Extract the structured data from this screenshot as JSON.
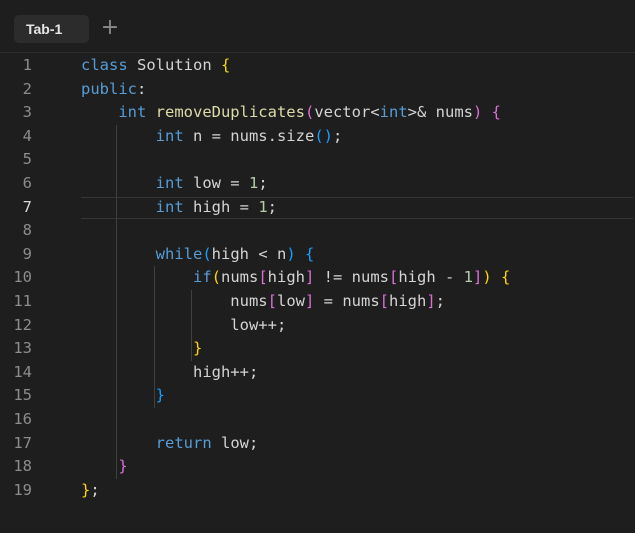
{
  "tabs": [
    {
      "label": "Tab-1"
    }
  ],
  "add_tab_symbol": "+",
  "editor": {
    "line_numbers": [
      "1",
      "2",
      "3",
      "4",
      "5",
      "6",
      "7",
      "8",
      "9",
      "10",
      "11",
      "12",
      "13",
      "14",
      "15",
      "16",
      "17",
      "18",
      "19"
    ],
    "current_line": 7,
    "lines": [
      [
        {
          "t": "class ",
          "c": "kw"
        },
        {
          "t": "Solution ",
          "c": "id"
        },
        {
          "t": "{",
          "c": "p1"
        }
      ],
      [
        {
          "t": "public",
          "c": "kw"
        },
        {
          "t": ":",
          "c": "id"
        }
      ],
      [
        {
          "t": "    int ",
          "c": "ty"
        },
        {
          "t": "removeDuplicates",
          "c": "fn"
        },
        {
          "t": "(",
          "c": "p2"
        },
        {
          "t": "vector",
          "c": "id"
        },
        {
          "t": "<",
          "c": "id"
        },
        {
          "t": "int",
          "c": "ty"
        },
        {
          "t": ">& nums",
          "c": "id"
        },
        {
          "t": ")",
          "c": "p2"
        },
        {
          "t": " ",
          "c": "id"
        },
        {
          "t": "{",
          "c": "p2"
        }
      ],
      [
        {
          "t": "        int ",
          "c": "ty"
        },
        {
          "t": "n = nums.size",
          "c": "id"
        },
        {
          "t": "()",
          "c": "p3"
        },
        {
          "t": ";",
          "c": "id"
        }
      ],
      [],
      [
        {
          "t": "        int ",
          "c": "ty"
        },
        {
          "t": "low = ",
          "c": "id"
        },
        {
          "t": "1",
          "c": "num"
        },
        {
          "t": ";",
          "c": "id"
        }
      ],
      [
        {
          "t": "        int ",
          "c": "ty"
        },
        {
          "t": "high = ",
          "c": "id"
        },
        {
          "t": "1",
          "c": "num"
        },
        {
          "t": ";",
          "c": "id"
        }
      ],
      [],
      [
        {
          "t": "        while",
          "c": "kw"
        },
        {
          "t": "(",
          "c": "p3"
        },
        {
          "t": "high < n",
          "c": "id"
        },
        {
          "t": ")",
          "c": "p3"
        },
        {
          "t": " ",
          "c": "id"
        },
        {
          "t": "{",
          "c": "p3"
        }
      ],
      [
        {
          "t": "            if",
          "c": "kw"
        },
        {
          "t": "(",
          "c": "p1"
        },
        {
          "t": "nums",
          "c": "id"
        },
        {
          "t": "[",
          "c": "p2"
        },
        {
          "t": "high",
          "c": "id"
        },
        {
          "t": "]",
          "c": "p2"
        },
        {
          "t": " != nums",
          "c": "id"
        },
        {
          "t": "[",
          "c": "p2"
        },
        {
          "t": "high - ",
          "c": "id"
        },
        {
          "t": "1",
          "c": "num"
        },
        {
          "t": "]",
          "c": "p2"
        },
        {
          "t": ")",
          "c": "p1"
        },
        {
          "t": " ",
          "c": "id"
        },
        {
          "t": "{",
          "c": "p1"
        }
      ],
      [
        {
          "t": "                nums",
          "c": "id"
        },
        {
          "t": "[",
          "c": "p2"
        },
        {
          "t": "low",
          "c": "id"
        },
        {
          "t": "]",
          "c": "p2"
        },
        {
          "t": " = nums",
          "c": "id"
        },
        {
          "t": "[",
          "c": "p2"
        },
        {
          "t": "high",
          "c": "id"
        },
        {
          "t": "]",
          "c": "p2"
        },
        {
          "t": ";",
          "c": "id"
        }
      ],
      [
        {
          "t": "                low++;",
          "c": "id"
        }
      ],
      [
        {
          "t": "            }",
          "c": "p1"
        }
      ],
      [
        {
          "t": "            high++;",
          "c": "id"
        }
      ],
      [
        {
          "t": "        }",
          "c": "p3"
        }
      ],
      [],
      [
        {
          "t": "        return ",
          "c": "kw"
        },
        {
          "t": "low;",
          "c": "id"
        }
      ],
      [
        {
          "t": "    }",
          "c": "p2"
        }
      ],
      [
        {
          "t": "}",
          "c": "p1"
        },
        {
          "t": ";",
          "c": "id"
        }
      ]
    ]
  },
  "colors": {
    "background": "#1e1e1e",
    "keyword": "#569cd6",
    "function": "#dcdcaa",
    "number": "#b5cea8",
    "bracket_level_1": "#ffd700",
    "bracket_level_2": "#da70d6",
    "bracket_level_3": "#179fff",
    "text": "#d4d4d4",
    "line_number": "#8c8c8c"
  }
}
